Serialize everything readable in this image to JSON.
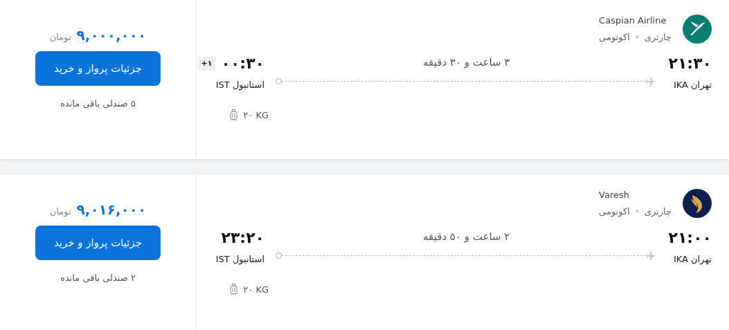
{
  "flights": [
    {
      "airline": "Caspian Airline",
      "logo": {
        "kind": "dove"
      },
      "tags": [
        "چارتری",
        "اکونومی"
      ],
      "departure": {
        "time": "۲۱:۳۰",
        "airport": "تهران IKA"
      },
      "duration": "۳ ساعت و ۳۰ دقیقه",
      "arrival": {
        "time": "۰۰:۳۰",
        "airport": "استانبول IST",
        "day_offset": "+۱"
      },
      "baggage": "۲۰ KG",
      "price": "۹,۰۰۰,۰۰۰",
      "currency": "تومان",
      "button": "جزئیات پرواز و خرید",
      "seats": "۵ صندلی باقی مانده"
    },
    {
      "airline": "Varesh",
      "logo": {
        "kind": "wing"
      },
      "tags": [
        "چارتری",
        "اکونومی"
      ],
      "departure": {
        "time": "۲۱:۰۰",
        "airport": "تهران IKA"
      },
      "duration": "۲ ساعت و ۵۰ دقیقه",
      "arrival": {
        "time": "۲۳:۲۰",
        "airport": "استانبول IST"
      },
      "baggage": "۲۰ KG",
      "price": "۹,۰۱۶,۰۰۰",
      "currency": "تومان",
      "button": "جزئیات پرواز و خرید",
      "seats": "۲ صندلی باقی مانده"
    }
  ]
}
